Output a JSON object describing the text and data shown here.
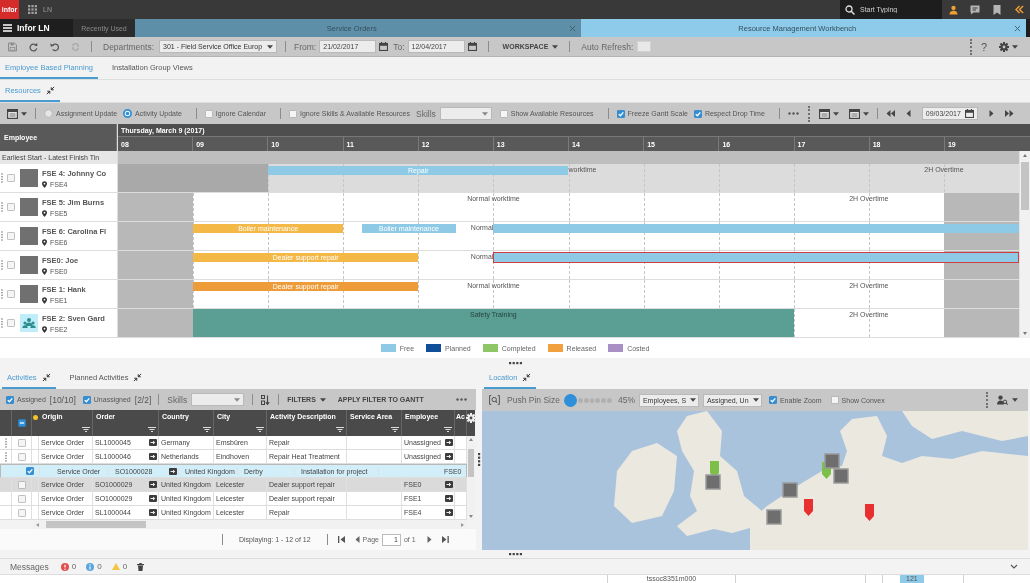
{
  "top_bar": {
    "logo": "infor",
    "app": "LN",
    "search": {
      "placeholder": "Start Typing"
    }
  },
  "nav": {
    "title": "Infor LN",
    "recent": "Recently Used",
    "tabs": [
      {
        "label": "Service Orders",
        "selected": false
      },
      {
        "label": "Resource Management Workbench",
        "selected": true
      }
    ]
  },
  "toolbar": {
    "departments_label": "Departments:",
    "department": "301 - Field Service Office Europ",
    "from_label": "From:",
    "from": "21/02/2017",
    "to_label": "To:",
    "to": "12/04/2017",
    "workspace": "WORKSPACE",
    "auto_refresh_label": "Auto Refresh:",
    "auto_refresh": false,
    "help": "?"
  },
  "view_tabs": [
    {
      "label": "Employee Based Planning",
      "selected": true
    },
    {
      "label": "Installation Group Views",
      "selected": false
    }
  ],
  "resources": {
    "tab": "Resources",
    "options": [
      [
        {
          "kind": "radio",
          "label": "Assignment Update",
          "selected": false
        },
        {
          "kind": "radio",
          "label": "Activity Update",
          "selected": true
        }
      ],
      [
        {
          "kind": "checkbox",
          "label": "Ignore Calendar",
          "checked": false
        }
      ],
      [
        {
          "kind": "checkbox",
          "label": "Ignore Skills & Available Resources",
          "checked": false
        },
        {
          "kind": "select",
          "label": "Skills"
        },
        {
          "kind": "checkbox",
          "label": "Show Available Resources",
          "checked": false
        }
      ],
      [
        {
          "kind": "checkbox",
          "label": "Freeze Gantt Scale",
          "checked": true
        },
        {
          "kind": "checkbox",
          "label": "Respect Drop Time",
          "checked": true
        }
      ]
    ],
    "date": "09/03/2017",
    "gantt": {
      "column": "Employee",
      "day": "Thursday, March 9 (2017)",
      "hours": [
        "08",
        "09",
        "10",
        "11",
        "12",
        "13",
        "14",
        "15",
        "16",
        "17",
        "18",
        "19"
      ],
      "filter_row": "Earliest Start - Latest Finish Tin",
      "rows": [
        {
          "name": "FSE 4: Johnny Co",
          "location": "FSE4",
          "photo": true,
          "checked": false,
          "highlighted": true,
          "bars": [
            {
              "label": "Repair",
              "color": "#8ecae6",
              "block": false,
              "outlined": false
            }
          ],
          "markers": [
            "worktime",
            "2H Overtime"
          ]
        },
        {
          "name": "FSE 5: Jim Burns",
          "location": "FSE5",
          "photo": true,
          "checked": false,
          "highlighted": false,
          "markers": [
            "Normal worktime",
            "2H Overtime"
          ]
        },
        {
          "name": "FSE 6: Carolina Fl",
          "location": "FSE6",
          "photo": true,
          "checked": false,
          "highlighted": false,
          "bars": [
            {
              "label": "Boiler maintenance",
              "color": "#f3b846",
              "block": false,
              "outlined": false
            },
            {
              "label": "Boiler maintenance",
              "color": "#8ecae6",
              "block": false,
              "outlined": false
            },
            {
              "color": "#8ecae6",
              "block": false,
              "outlined": false
            }
          ],
          "markers": [
            "Normal"
          ]
        },
        {
          "name": "FSE0: Joe",
          "location": "FSE0",
          "photo": true,
          "checked": false,
          "highlighted": false,
          "bars": [
            {
              "label": "Dealer support repair",
              "color": "#f3b846",
              "block": false,
              "outlined": false
            },
            {
              "color": "#8ecae6",
              "block": false,
              "outlined": true
            }
          ],
          "markers": [
            "Normal"
          ]
        },
        {
          "name": "FSE 1: Hank",
          "location": "FSE1",
          "photo": true,
          "checked": false,
          "highlighted": false,
          "bars": [
            {
              "label": "Dealer support repair",
              "color": "#ee9c3a",
              "block": false,
              "outlined": false
            }
          ],
          "markers": [
            "Normal worktime",
            "2H Overtime"
          ]
        },
        {
          "name": "FSE 2: Sven Gard",
          "location": "FSE2",
          "photo": false,
          "checked": false,
          "highlighted": false,
          "bars": [
            {
              "label": "Safety Training",
              "color": "#5a9e94",
              "block": true,
              "outlined": false
            }
          ],
          "markers": [
            "2H Overtime"
          ]
        }
      ]
    },
    "legend": [
      {
        "label": "Free",
        "color": "#8ecae6"
      },
      {
        "label": "Planned",
        "color": "#0f4f9a"
      },
      {
        "label": "Completed",
        "color": "#8cc665"
      },
      {
        "label": "Released",
        "color": "#f0a03c"
      },
      {
        "label": "Costed",
        "color": "#a88fc4"
      }
    ]
  },
  "activities": {
    "tabs": [
      {
        "label": "Activities",
        "selected": true
      },
      {
        "label": "Planned Activities",
        "selected": false
      }
    ],
    "filters": [
      {
        "label": "Assigned",
        "count": "[10/10]",
        "checked": true
      },
      {
        "label": "Unassigned",
        "count": "[2/2]",
        "checked": true
      }
    ],
    "skills_label": "Skills",
    "filters_menu": "FILTERS",
    "apply_filter": "APPLY FILTER TO GANTT",
    "table": {
      "header_indeterminate": true,
      "columns": [
        "Origin",
        "Order",
        "Country",
        "City",
        "Activity Description",
        "Service Area",
        "Employee",
        "Ac"
      ],
      "rows": [
        {
          "origin": "Service Order",
          "order": "SL1000045",
          "country": "Germany",
          "city": "Emsbüren",
          "description": "Repair",
          "employee": "Unassigned",
          "selected": false,
          "highlighted": false,
          "handle": true
        },
        {
          "origin": "Service Order",
          "order": "SL1000046",
          "country": "Netherlands",
          "city": "Eindhoven",
          "description": "Repair Heat Treatment",
          "employee": "Unassigned",
          "selected": false,
          "highlighted": false,
          "handle": true
        },
        {
          "origin": "Service Order",
          "order": "SO1000028",
          "country": "United Kingdom",
          "city": "Derby",
          "description": "Installation for project",
          "employee": "FSE0",
          "selected": true,
          "highlighted": false,
          "handle": false
        },
        {
          "origin": "Service Order",
          "order": "SO1000029",
          "country": "United Kingdom",
          "city": "Leicester",
          "description": "Dealer support repair",
          "employee": "FSE0",
          "selected": false,
          "highlighted": true,
          "handle": false
        },
        {
          "origin": "Service Order",
          "order": "SO1000029",
          "country": "United Kingdom",
          "city": "Leicester",
          "description": "Dealer support repair",
          "employee": "FSE1",
          "selected": false,
          "highlighted": false,
          "handle": false
        },
        {
          "origin": "Service Order",
          "order": "SL1000044",
          "country": "United Kingdom",
          "city": "Leicester",
          "description": "Repair",
          "employee": "FSE4",
          "selected": false,
          "highlighted": false,
          "handle": false
        }
      ]
    },
    "pager": {
      "summary": "Displaying: 1 - 12 of 12",
      "page_label": "Page",
      "page": "1",
      "page_total": "of 1"
    }
  },
  "location": {
    "tab": "Location",
    "pin_size_label": "Push Pin Size",
    "pin_size": {
      "level": 0
    },
    "pin_size_reading": "45%",
    "layer": "Employees, S",
    "assignment": "Assigned, Un",
    "options": [
      {
        "label": "Enable Zoom",
        "checked": true
      },
      {
        "label": "Show Convex",
        "checked": false
      }
    ]
  },
  "messages": {
    "label": "Messages",
    "errors": "0",
    "infos": "0",
    "warnings": "0"
  },
  "status_bar": [
    {
      "text": "tssoc8351m000",
      "highlighted": false
    },
    {
      "text": "121",
      "highlighted": true
    }
  ]
}
